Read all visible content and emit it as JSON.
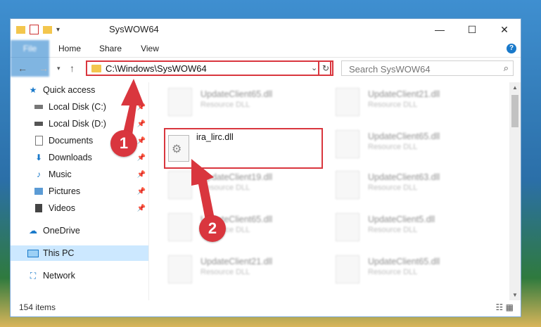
{
  "window": {
    "title": "SysWOW64"
  },
  "titlebar": {
    "minimize": "—",
    "maximize": "☐",
    "close": "✕"
  },
  "ribbon": {
    "tabs": [
      "File",
      "Home",
      "Share",
      "View"
    ],
    "help": "?"
  },
  "address": {
    "path": "C:\\Windows\\SysWOW64",
    "refresh": "↻",
    "search_placeholder": "Search SysWOW64"
  },
  "sidebar": {
    "items": [
      {
        "label": "Quick access",
        "icon": "star-icon"
      },
      {
        "label": "Local Disk (C:)",
        "icon": "drive-icon"
      },
      {
        "label": "Local Disk (D:)",
        "icon": "drive-icon"
      },
      {
        "label": "Documents",
        "icon": "document-icon"
      },
      {
        "label": "Downloads",
        "icon": "download-icon"
      },
      {
        "label": "Music",
        "icon": "music-icon"
      },
      {
        "label": "Pictures",
        "icon": "pictures-icon"
      },
      {
        "label": "Videos",
        "icon": "videos-icon"
      },
      {
        "label": "OneDrive",
        "icon": "cloud-icon"
      },
      {
        "label": "This PC",
        "icon": "monitor-icon"
      },
      {
        "label": "Network",
        "icon": "network-icon"
      }
    ]
  },
  "files": [
    {
      "name": "UpdateClient65.dll",
      "type": "Resource DLL"
    },
    {
      "name": "UpdateClient21.dll",
      "type": "Resource DLL"
    },
    {
      "name": "UpdateClient65.dll",
      "type": "Resource DLL"
    },
    {
      "name": "UpdateClient19.dll",
      "type": "Resource DLL"
    },
    {
      "name": "UpdateClient63.dll",
      "type": "Resource DLL"
    },
    {
      "name": "UpdateClient65.dll",
      "type": "Resource DLL"
    },
    {
      "name": "UpdateClient5.dll",
      "type": "Resource DLL"
    },
    {
      "name": "UpdateClient21.dll",
      "type": "Resource DLL"
    },
    {
      "name": "UpdateClient65.dll",
      "type": "Resource DLL"
    }
  ],
  "highlighted_file": {
    "name": "ira_lirc.dll"
  },
  "status": {
    "count": "154 items"
  },
  "badges": {
    "one": "1",
    "two": "2"
  },
  "colors": {
    "accent": "#1979ca",
    "highlight": "#d9363e"
  }
}
